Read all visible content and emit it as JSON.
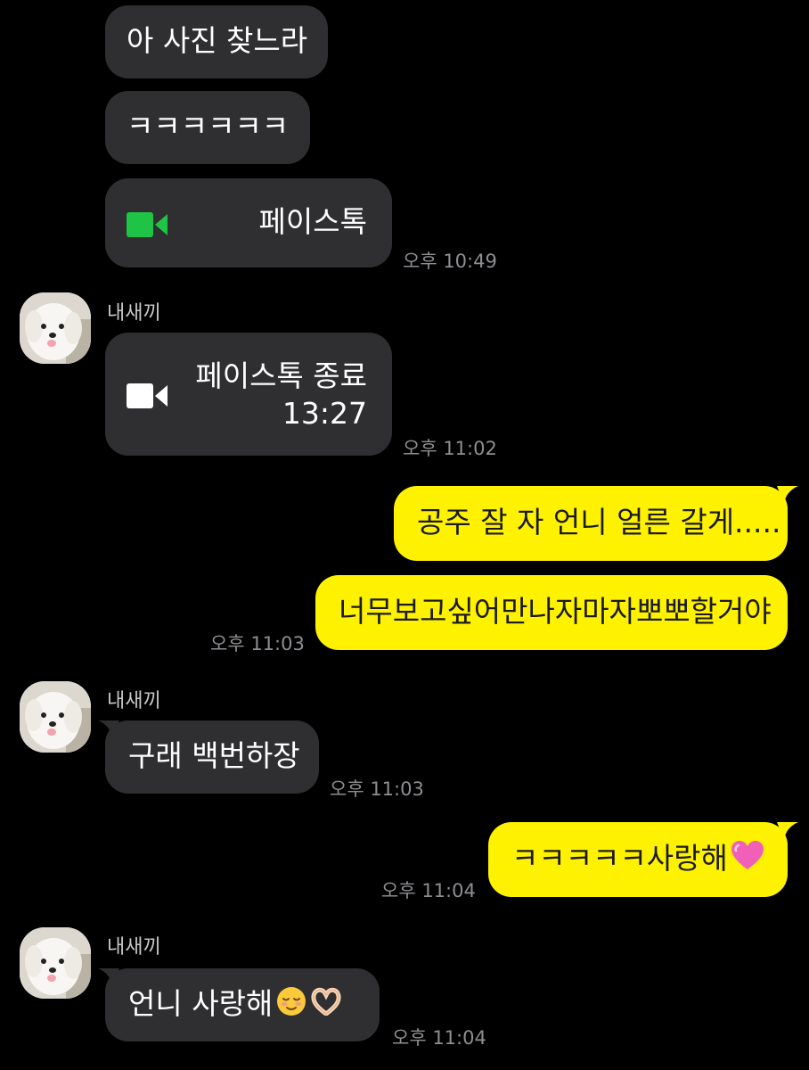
{
  "contact": {
    "name": "내새끼"
  },
  "messages": {
    "m1": "아 사진 찾느라",
    "m2": "ㅋㅋㅋㅋㅋㅋ",
    "m3": "페이스톡",
    "m3_time": "오후 10:49",
    "m4_title": "페이스톡 종료",
    "m4_duration": "13:27",
    "m4_time": "오후 11:02",
    "m5": "공주 잘 자 언니 얼른 갈게.....",
    "m6": "너무보고싶어만나자마자뽀뽀할거야",
    "m6_time": "오후 11:03",
    "m7": "구래 백번하장",
    "m7_time": "오후 11:03",
    "m8": "ㅋㅋㅋㅋㅋ사랑해",
    "m8_time": "오후 11:04",
    "m9": "언니 사랑해",
    "m9_time": "오후 11:04"
  },
  "icons": {
    "facetalk_start": "video-camera-icon",
    "facetalk_end": "video-camera-icon",
    "heart": "pink-heart-emoji",
    "relieved": "relieved-face-emoji",
    "heart_hands": "heart-hands-emoji"
  },
  "colors": {
    "background": "#000000",
    "incoming_bubble": "#2f2f31",
    "outgoing_bubble": "#fff200",
    "facetalk_green": "#1fc345",
    "timestamp": "#8e8e93"
  }
}
